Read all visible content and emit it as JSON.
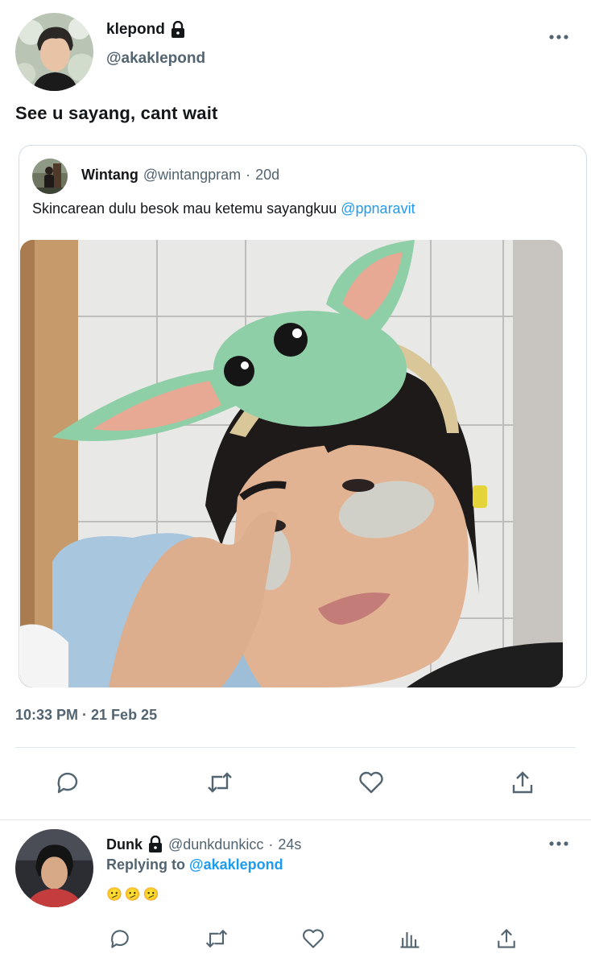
{
  "tweet": {
    "author_name": "klepond",
    "author_handle": "@akaklepond",
    "text": "See u sayang, cant wait",
    "timestamp": "10:33 PM · 21 Feb 25"
  },
  "quote": {
    "author_name": "Wintang",
    "author_handle": "@wintangpram",
    "separator": "·",
    "time": "20d",
    "text": "Skincarean dulu besok mau ketemu sayangkuu",
    "mention": "@ppnaravit"
  },
  "reply": {
    "author_name": "Dunk",
    "author_handle": "@dunkdunkicc",
    "separator": "·",
    "time": "24s",
    "replying_label": "Replying to",
    "replying_to": "@akaklepond",
    "emojis": "🫤🫤🫤"
  },
  "icons": {
    "lock": "lock-icon",
    "more": "more-horizontal-icon",
    "reply": "reply-icon",
    "retweet": "retweet-icon",
    "like": "heart-icon",
    "share": "share-icon",
    "views": "views-icon"
  },
  "colors": {
    "accent": "#1d9bf0",
    "text_primary": "#14171a",
    "text_secondary": "#536471",
    "border": "#d6dde3"
  }
}
